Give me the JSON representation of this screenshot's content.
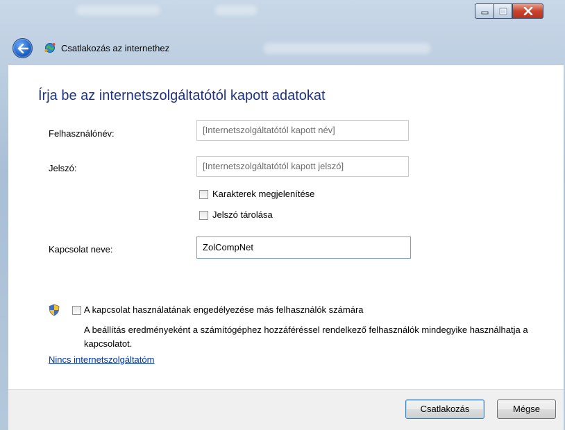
{
  "window": {
    "title": "Csatlakozás az internethez"
  },
  "heading": "Írja be az internetszolgáltatótól kapott adatokat",
  "form": {
    "username_label": "Felhasználónév:",
    "username_placeholder": "[Internetszolgáltatótól kapott név]",
    "password_label": "Jelszó:",
    "password_placeholder": "[Internetszolgáltatótól kapott jelszó]",
    "show_chars_label": "Karakterek megjelenítése",
    "show_chars_checked": false,
    "remember_label": "Jelszó tárolása",
    "remember_checked": false,
    "connection_name_label": "Kapcsolat neve:",
    "connection_name_value": "ZolCompNet"
  },
  "sharing": {
    "allow_label": "A kapcsolat használatának engedélyezése más felhasználók számára",
    "allow_checked": false,
    "description": "A beállítás eredményeként a számítógéphez hozzáféréssel rendelkező felhasználók mindegyike használhatja a kapcsolatot."
  },
  "no_isp_link": "Nincs internetszolgáltatóm",
  "buttons": {
    "connect": "Csatlakozás",
    "cancel": "Mégse"
  },
  "icons": {
    "back": "back-arrow-icon",
    "network": "network-globe-icon",
    "shield": "uac-shield-icon"
  },
  "colors": {
    "heading": "#1e3287",
    "link": "#0033aa"
  }
}
